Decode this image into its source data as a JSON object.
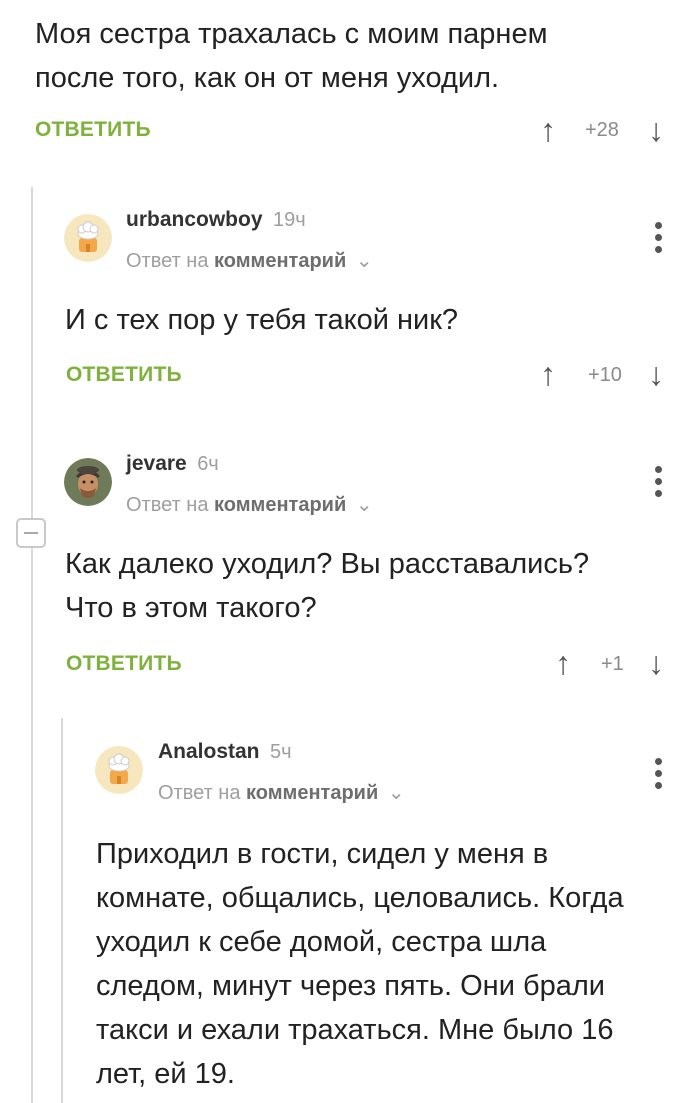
{
  "root": {
    "text_line1": "Моя сестра трахалась с моим парнем",
    "text_line2": "после того, как он от меня уходил.",
    "reply_label": "ОТВЕТИТЬ",
    "rating": "+28"
  },
  "comments": [
    {
      "username": "urbancowboy",
      "time": "19ч",
      "reply_to_prefix": "Ответ на",
      "reply_to_link": "комментарий",
      "text_lines": [
        "И с тех пор у тебя такой ник?"
      ],
      "reply_label": "ОТВЕТИТЬ",
      "rating": "+10"
    },
    {
      "username": "jevare",
      "time": "6ч",
      "reply_to_prefix": "Ответ на",
      "reply_to_link": "комментарий",
      "text_lines": [
        "Как далеко уходил? Вы расставались?",
        "Что в этом такого?"
      ],
      "reply_label": "ОТВЕТИТЬ",
      "rating": "+1"
    },
    {
      "username": "Analostan",
      "time": "5ч",
      "reply_to_prefix": "Ответ на",
      "reply_to_link": "комментарий",
      "text_lines": [
        "Приходил в гости, сидел у меня в",
        "комнате, общались, целовались. Когда",
        "уходил к себе домой, сестра шла",
        "следом, минут через пять. Они брали",
        "такси и ехали трахаться. Мне было 16",
        "лет, ей 19."
      ]
    }
  ],
  "icons": {
    "upvote": "arrow-up-icon",
    "downvote": "arrow-down-icon",
    "menu": "more-vertical-icon",
    "collapse": "minus-icon",
    "chevron": "chevron-down-icon"
  },
  "colors": {
    "reply_green": "#7fb23c",
    "thread_line": "#d9d9d9"
  }
}
